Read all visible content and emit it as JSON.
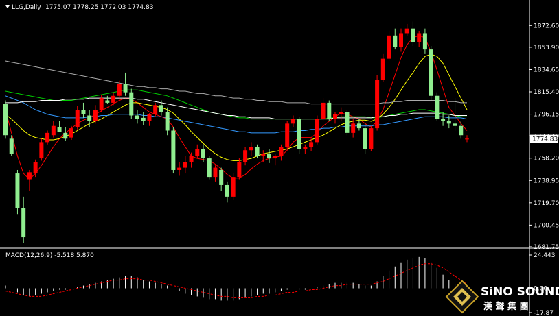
{
  "chart_data": [
    {
      "type": "candlestick",
      "title": "LLG,Daily",
      "ohlc_text": "1775.07 1778.25 1772.03 1774.83",
      "current_price": 1774.83,
      "ylim": [
        1681.75,
        1884
      ],
      "yticks": [
        1872.6,
        1853.9,
        1834.65,
        1815.4,
        1796.15,
        1777.4,
        1758.2,
        1738.95,
        1719.7,
        1700.45,
        1681.75
      ],
      "ytick_labels": [
        "1872.60",
        "1853.90",
        "1834.65",
        "1815.40",
        "1796.15",
        "1777.40",
        "1758.20",
        "1738.95",
        "1719.70",
        "1700.45",
        "1681.75"
      ],
      "colors": {
        "up": "#ff0000",
        "down": "#90ee90",
        "ma1": "#ff0000",
        "ma2": "#ffff00",
        "ma3": "#00cc00",
        "ma4": "#3399ff",
        "ma5": "#ffffff",
        "ma6": "#aaaaaa"
      },
      "candles": [
        [
          1805,
          1808,
          1775,
          1778
        ],
        [
          1775,
          1778,
          1760,
          1762
        ],
        [
          1745,
          1748,
          1710,
          1715
        ],
        [
          1715,
          1725,
          1685,
          1690
        ],
        [
          1740,
          1748,
          1730,
          1746
        ],
        [
          1745,
          1757,
          1742,
          1755
        ],
        [
          1758,
          1775,
          1756,
          1772
        ],
        [
          1772,
          1782,
          1770,
          1780
        ],
        [
          1778,
          1790,
          1776,
          1786
        ],
        [
          1785,
          1790,
          1781,
          1781
        ],
        [
          1780,
          1785,
          1773,
          1775
        ],
        [
          1776,
          1786,
          1774,
          1784
        ],
        [
          1785,
          1803,
          1783,
          1800
        ],
        [
          1800,
          1806,
          1793,
          1796
        ],
        [
          1795,
          1800,
          1785,
          1790
        ],
        [
          1790,
          1804,
          1788,
          1800
        ],
        [
          1800,
          1813,
          1798,
          1810
        ],
        [
          1808,
          1812,
          1805,
          1806
        ],
        [
          1806,
          1815,
          1804,
          1812
        ],
        [
          1812,
          1825,
          1810,
          1822
        ],
        [
          1822,
          1832,
          1812,
          1815
        ],
        [
          1815,
          1818,
          1792,
          1795
        ],
        [
          1795,
          1800,
          1788,
          1792
        ],
        [
          1793,
          1798,
          1787,
          1790
        ],
        [
          1790,
          1797,
          1786,
          1796
        ],
        [
          1796,
          1806,
          1794,
          1804
        ],
        [
          1804,
          1808,
          1795,
          1798
        ],
        [
          1798,
          1802,
          1778,
          1782
        ],
        [
          1782,
          1785,
          1745,
          1748
        ],
        [
          1748,
          1755,
          1743,
          1750
        ],
        [
          1750,
          1760,
          1745,
          1755
        ],
        [
          1755,
          1763,
          1750,
          1760
        ],
        [
          1760,
          1770,
          1758,
          1766
        ],
        [
          1766,
          1770,
          1755,
          1758
        ],
        [
          1758,
          1760,
          1740,
          1742
        ],
        [
          1742,
          1752,
          1738,
          1750
        ],
        [
          1748,
          1750,
          1730,
          1735
        ],
        [
          1735,
          1738,
          1720,
          1725
        ],
        [
          1725,
          1745,
          1722,
          1742
        ],
        [
          1742,
          1758,
          1740,
          1755
        ],
        [
          1755,
          1768,
          1752,
          1765
        ],
        [
          1765,
          1772,
          1760,
          1768
        ],
        [
          1768,
          1770,
          1758,
          1760
        ],
        [
          1760,
          1765,
          1755,
          1762
        ],
        [
          1762,
          1766,
          1754,
          1758
        ],
        [
          1758,
          1762,
          1752,
          1760
        ],
        [
          1760,
          1770,
          1756,
          1768
        ],
        [
          1768,
          1790,
          1766,
          1788
        ],
        [
          1788,
          1795,
          1785,
          1792
        ],
        [
          1792,
          1794,
          1762,
          1766
        ],
        [
          1766,
          1770,
          1762,
          1768
        ],
        [
          1768,
          1775,
          1764,
          1772
        ],
        [
          1772,
          1795,
          1770,
          1792
        ],
        [
          1792,
          1810,
          1790,
          1806
        ],
        [
          1806,
          1808,
          1790,
          1792
        ],
        [
          1792,
          1798,
          1788,
          1796
        ],
        [
          1796,
          1802,
          1790,
          1798
        ],
        [
          1798,
          1800,
          1778,
          1780
        ],
        [
          1780,
          1792,
          1776,
          1788
        ],
        [
          1788,
          1792,
          1782,
          1784
        ],
        [
          1784,
          1788,
          1762,
          1766
        ],
        [
          1766,
          1786,
          1764,
          1784
        ],
        [
          1784,
          1830,
          1782,
          1826
        ],
        [
          1826,
          1848,
          1824,
          1844
        ],
        [
          1844,
          1868,
          1842,
          1864
        ],
        [
          1864,
          1870,
          1852,
          1854
        ],
        [
          1854,
          1870,
          1850,
          1866
        ],
        [
          1866,
          1874,
          1864,
          1870
        ],
        [
          1870,
          1876,
          1855,
          1858
        ],
        [
          1858,
          1868,
          1854,
          1866
        ],
        [
          1866,
          1870,
          1848,
          1852
        ],
        [
          1852,
          1855,
          1808,
          1812
        ],
        [
          1812,
          1815,
          1790,
          1792
        ],
        [
          1792,
          1798,
          1786,
          1790
        ],
        [
          1790,
          1795,
          1784,
          1788
        ],
        [
          1788,
          1810,
          1782,
          1786
        ],
        [
          1786,
          1790,
          1775,
          1778
        ],
        [
          1775,
          1778,
          1772,
          1775
        ]
      ],
      "mas": [
        {
          "color": "#ff0000",
          "values": [
            1800,
            1780,
            1760,
            1745,
            1740,
            1745,
            1752,
            1760,
            1768,
            1775,
            1780,
            1784,
            1788,
            1791,
            1793,
            1796,
            1799,
            1802,
            1805,
            1808,
            1810,
            1809,
            1806,
            1802,
            1798,
            1796,
            1794,
            1792,
            1785,
            1776,
            1768,
            1760,
            1758,
            1757,
            1756,
            1753,
            1749,
            1744,
            1741,
            1741,
            1744,
            1749,
            1753,
            1756,
            1758,
            1759,
            1760,
            1765,
            1772,
            1776,
            1776,
            1776,
            1780,
            1786,
            1790,
            1794,
            1797,
            1796,
            1794,
            1792,
            1788,
            1785,
            1790,
            1800,
            1815,
            1830,
            1845,
            1856,
            1862,
            1864,
            1862,
            1850,
            1834,
            1818,
            1802,
            1795,
            1788,
            1782
          ]
        },
        {
          "color": "#ffff00",
          "values": [
            1796,
            1792,
            1787,
            1782,
            1778,
            1776,
            1775,
            1774,
            1774,
            1775,
            1777,
            1779,
            1782,
            1785,
            1788,
            1790,
            1792,
            1795,
            1798,
            1801,
            1804,
            1806,
            1806,
            1805,
            1804,
            1803,
            1802,
            1800,
            1797,
            1792,
            1787,
            1781,
            1776,
            1771,
            1766,
            1762,
            1759,
            1757,
            1756,
            1756,
            1757,
            1758,
            1760,
            1762,
            1763,
            1764,
            1765,
            1766,
            1768,
            1770,
            1772,
            1774,
            1776,
            1778,
            1781,
            1784,
            1787,
            1789,
            1790,
            1791,
            1791,
            1790,
            1792,
            1796,
            1802,
            1809,
            1817,
            1825,
            1832,
            1840,
            1846,
            1848,
            1846,
            1840,
            1830,
            1820,
            1810,
            1800
          ]
        },
        {
          "color": "#00cc00",
          "values": [
            1816,
            1815,
            1814,
            1813,
            1812,
            1811,
            1810,
            1809,
            1808,
            1808,
            1808,
            1808,
            1809,
            1810,
            1811,
            1812,
            1813,
            1814,
            1815,
            1816,
            1817,
            1817,
            1817,
            1816,
            1815,
            1814,
            1813,
            1812,
            1810,
            1808,
            1806,
            1804,
            1802,
            1800,
            1798,
            1797,
            1796,
            1795,
            1794,
            1793,
            1793,
            1792,
            1792,
            1792,
            1792,
            1792,
            1792,
            1792,
            1792,
            1792,
            1792,
            1792,
            1792,
            1792,
            1793,
            1793,
            1794,
            1794,
            1794,
            1794,
            1794,
            1793,
            1793,
            1794,
            1795,
            1796,
            1797,
            1798,
            1799,
            1800,
            1800,
            1799,
            1798,
            1797,
            1796,
            1795,
            1794,
            1794
          ]
        },
        {
          "color": "#3399ff",
          "values": [
            1812,
            1810,
            1808,
            1806,
            1803,
            1800,
            1798,
            1796,
            1795,
            1794,
            1793,
            1793,
            1793,
            1793,
            1794,
            1794,
            1795,
            1795,
            1796,
            1796,
            1796,
            1796,
            1796,
            1795,
            1795,
            1794,
            1794,
            1793,
            1792,
            1791,
            1790,
            1789,
            1788,
            1787,
            1786,
            1785,
            1784,
            1783,
            1782,
            1781,
            1781,
            1780,
            1780,
            1780,
            1780,
            1780,
            1781,
            1781,
            1781,
            1782,
            1782,
            1783,
            1783,
            1784,
            1784,
            1785,
            1785,
            1786,
            1786,
            1786,
            1786,
            1786,
            1787,
            1787,
            1788,
            1789,
            1790,
            1791,
            1792,
            1793,
            1794,
            1794,
            1794,
            1794,
            1793,
            1793,
            1793,
            1792
          ]
        },
        {
          "color": "#ffffff",
          "values": [
            1806,
            1806,
            1806,
            1807,
            1807,
            1807,
            1808,
            1808,
            1808,
            1808,
            1809,
            1809,
            1809,
            1809,
            1810,
            1810,
            1810,
            1810,
            1810,
            1810,
            1810,
            1810,
            1809,
            1809,
            1808,
            1807,
            1806,
            1805,
            1804,
            1803,
            1802,
            1801,
            1800,
            1799,
            1798,
            1797,
            1796,
            1795,
            1795,
            1794,
            1794,
            1793,
            1793,
            1793,
            1793,
            1792,
            1792,
            1792,
            1792,
            1792,
            1792,
            1792,
            1792,
            1792,
            1792,
            1793,
            1793,
            1793,
            1793,
            1793,
            1793,
            1793,
            1794,
            1794,
            1795,
            1795,
            1796,
            1796,
            1797,
            1797,
            1797,
            1797,
            1797,
            1796,
            1796,
            1795,
            1795,
            1795
          ]
        },
        {
          "color": "#aaaaaa",
          "values": [
            1842,
            1841,
            1840,
            1839,
            1838,
            1837,
            1836,
            1835,
            1834,
            1833,
            1832,
            1831,
            1830,
            1829,
            1828,
            1827,
            1826,
            1825,
            1824,
            1823,
            1822,
            1821,
            1820,
            1820,
            1819,
            1819,
            1818,
            1818,
            1817,
            1816,
            1816,
            1815,
            1814,
            1814,
            1813,
            1812,
            1812,
            1811,
            1810,
            1810,
            1809,
            1809,
            1808,
            1808,
            1807,
            1807,
            1807,
            1806,
            1806,
            1806,
            1806,
            1805,
            1805,
            1805,
            1805,
            1805,
            1805,
            1805,
            1805,
            1805,
            1805,
            1805,
            1805,
            1806,
            1806,
            1807,
            1807,
            1808,
            1808,
            1808,
            1808,
            1808,
            1808,
            1808,
            1807,
            1807,
            1806,
            1806
          ]
        }
      ]
    },
    {
      "type": "macd",
      "title": "MACD(12,26,9) -5.518 5.870",
      "ytick_labels": [
        "24.443",
        "0.00",
        "-17.87"
      ],
      "ylim": [
        -17.87,
        24.443
      ],
      "histogram": [
        2,
        0,
        -3,
        -5,
        -6,
        -5,
        -4,
        -3,
        -2,
        -1,
        -1,
        0,
        1,
        2,
        3,
        4,
        5,
        6,
        7,
        8,
        9,
        9,
        8,
        6,
        5,
        4,
        3,
        2,
        0,
        -2,
        -4,
        -5,
        -6,
        -7,
        -8,
        -8,
        -9,
        -9,
        -9,
        -8,
        -7,
        -6,
        -5,
        -4,
        -4,
        -3,
        -2,
        -1,
        0,
        -1,
        -1,
        0,
        1,
        2,
        3,
        4,
        4,
        4,
        4,
        3,
        2,
        2,
        5,
        9,
        13,
        16,
        19,
        21,
        22,
        23,
        22,
        19,
        15,
        10,
        6,
        3,
        0,
        -2
      ],
      "signal": [
        -2,
        -3,
        -4,
        -5,
        -6,
        -6,
        -6,
        -5,
        -4,
        -3,
        -2,
        -1,
        0,
        1,
        2,
        3,
        4,
        5,
        6,
        6,
        7,
        7,
        7,
        6,
        6,
        5,
        4,
        3,
        2,
        1,
        0,
        -1,
        -2,
        -3,
        -4,
        -5,
        -6,
        -6,
        -7,
        -7,
        -7,
        -7,
        -6,
        -6,
        -5,
        -5,
        -4,
        -3,
        -3,
        -2,
        -2,
        -1,
        -1,
        0,
        1,
        2,
        2,
        3,
        3,
        3,
        3,
        3,
        4,
        5,
        7,
        9,
        11,
        13,
        15,
        17,
        18,
        18,
        17,
        15,
        12,
        9,
        6,
        3
      ]
    }
  ],
  "logo": {
    "brand": "SiNO SOUND",
    "chinese": "漢 聲 集 團"
  }
}
